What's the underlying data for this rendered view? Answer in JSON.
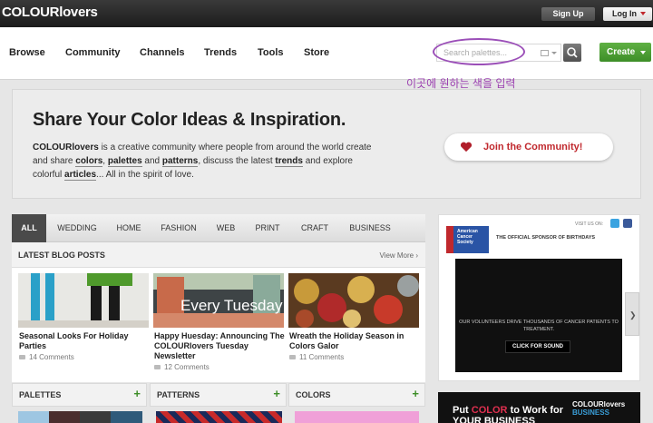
{
  "header": {
    "logo": "COLOURlovers",
    "signup": "Sign Up",
    "login": "Log In"
  },
  "nav": {
    "items": [
      "Browse",
      "Community",
      "Channels",
      "Trends",
      "Tools",
      "Store"
    ],
    "search_placeholder": "Search palettes...",
    "create": "Create"
  },
  "annotation": "이곳에 원하는 색을 입력",
  "hero": {
    "title": "Share Your Color Ideas & Inspiration.",
    "brand": "COLOURlovers",
    "text1": " is a creative community where people from around the world create and share ",
    "colors": "colors",
    "comma": ", ",
    "palettes": "palettes",
    "and": " and ",
    "patterns": "patterns",
    "text2": ", discuss the latest ",
    "trends": "trends",
    "text3": " and explore colorful ",
    "articles": "articles",
    "text4": "... All in the spirit of love.",
    "join": "Join the Community!"
  },
  "tabs": [
    "ALL",
    "WEDDING",
    "HOME",
    "FASHION",
    "WEB",
    "PRINT",
    "CRAFT",
    "BUSINESS"
  ],
  "blog": {
    "title": "LATEST BLOG POSTS",
    "view_more": "View More ›",
    "posts": [
      {
        "title": "Seasonal Looks For Holiday Parties",
        "comments": "14 Comments"
      },
      {
        "title": "Happy Huesday: Announcing The COLOURlovers Tuesday Newsletter",
        "comments": "12 Comments",
        "image_text": "Every Tuesday"
      },
      {
        "title": "Wreath the Holiday Season in Colors Galor",
        "comments": "11 Comments"
      }
    ]
  },
  "sections": [
    "PALETTES",
    "PATTERNS",
    "COLORS"
  ],
  "ad1": {
    "visit_us": "VISIT US ON:",
    "logo_text": "American Cancer Society",
    "sponsor": "THE OFFICIAL SPONSOR OF BIRTHDAYS",
    "video_text": "OUR VOLUNTEERS DRIVE THOUSANDS OF CANCER PATIENTS TO TREATMENT.",
    "click_sound": "CLICK FOR SOUND"
  },
  "ad2": {
    "line1_a": "Put ",
    "line1_b": "COLOR",
    "line1_c": " to Work for",
    "line2": "YOUR BUSINESS",
    "brand": "COLOURlovers",
    "brand_sub": "BUSINESS"
  },
  "colors": {
    "accent_green": "#3d8e28",
    "accent_red": "#c0282d",
    "annotation_purple": "#9b3fb0"
  }
}
